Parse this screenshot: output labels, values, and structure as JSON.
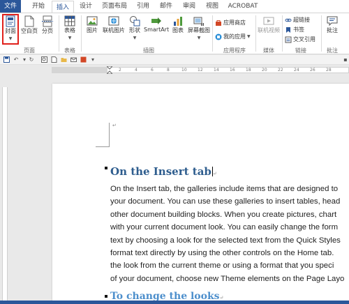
{
  "ribbon_tabs": [
    {
      "label": "文件"
    },
    {
      "label": "开始"
    },
    {
      "label": "插入"
    },
    {
      "label": "设计"
    },
    {
      "label": "页面布局"
    },
    {
      "label": "引用"
    },
    {
      "label": "邮件"
    },
    {
      "label": "审阅"
    },
    {
      "label": "视图"
    },
    {
      "label": "ACROBAT"
    }
  ],
  "active_tab": "插入",
  "ribbon": {
    "pages_group": {
      "label": "页面",
      "buttons": [
        {
          "label": "封面",
          "highlighted": true
        },
        {
          "label": "空白页"
        },
        {
          "label": "分页"
        }
      ]
    },
    "tables_group": {
      "label": "表格",
      "buttons": [
        {
          "label": "表格"
        }
      ]
    },
    "illustrations_group": {
      "label": "插图",
      "buttons": [
        {
          "label": "图片"
        },
        {
          "label": "联机图片"
        },
        {
          "label": "形状"
        },
        {
          "label": "SmartArt"
        },
        {
          "label": "图表"
        },
        {
          "label": "屏幕截图"
        }
      ]
    },
    "apps_group": {
      "label": "应用程序",
      "buttons": [
        {
          "label": "应用商店"
        },
        {
          "label": "我的应用"
        }
      ]
    },
    "media_group": {
      "label": "媒体",
      "buttons": [
        {
          "label": "联机视频"
        }
      ]
    },
    "links_group": {
      "label": "链接",
      "buttons": [
        {
          "label": "超链接"
        },
        {
          "label": "书签"
        },
        {
          "label": "交叉引用"
        }
      ]
    },
    "comments_group": {
      "label": "批注",
      "buttons": [
        {
          "label": "批注"
        }
      ]
    }
  },
  "document": {
    "heading": "On the Insert tab",
    "body_lines": [
      "On the Insert tab, the galleries include items that are designed to",
      "your document. You can use these galleries to insert tables, head",
      "other document building blocks. When you create pictures, chart",
      "with your current document look. You can easily change the form",
      "text by choosing a look for the selected text from the Quick Styles",
      "format text directly by using the other controls on the Home tab.",
      "the look from the current theme or using a format that you speci",
      "of your document, choose new Theme elements on the Page Layo"
    ],
    "subheading": "To change the looks"
  },
  "ruler_ticks": [
    "2",
    "4",
    "6",
    "8",
    "10",
    "12",
    "14",
    "16",
    "18",
    "20",
    "22",
    "24",
    "26",
    "28"
  ],
  "colors": {
    "accent": "#2b579a",
    "heading": "#2e5d8e",
    "subheading": "#4d8fcc",
    "highlight_box": "#e0201b"
  }
}
